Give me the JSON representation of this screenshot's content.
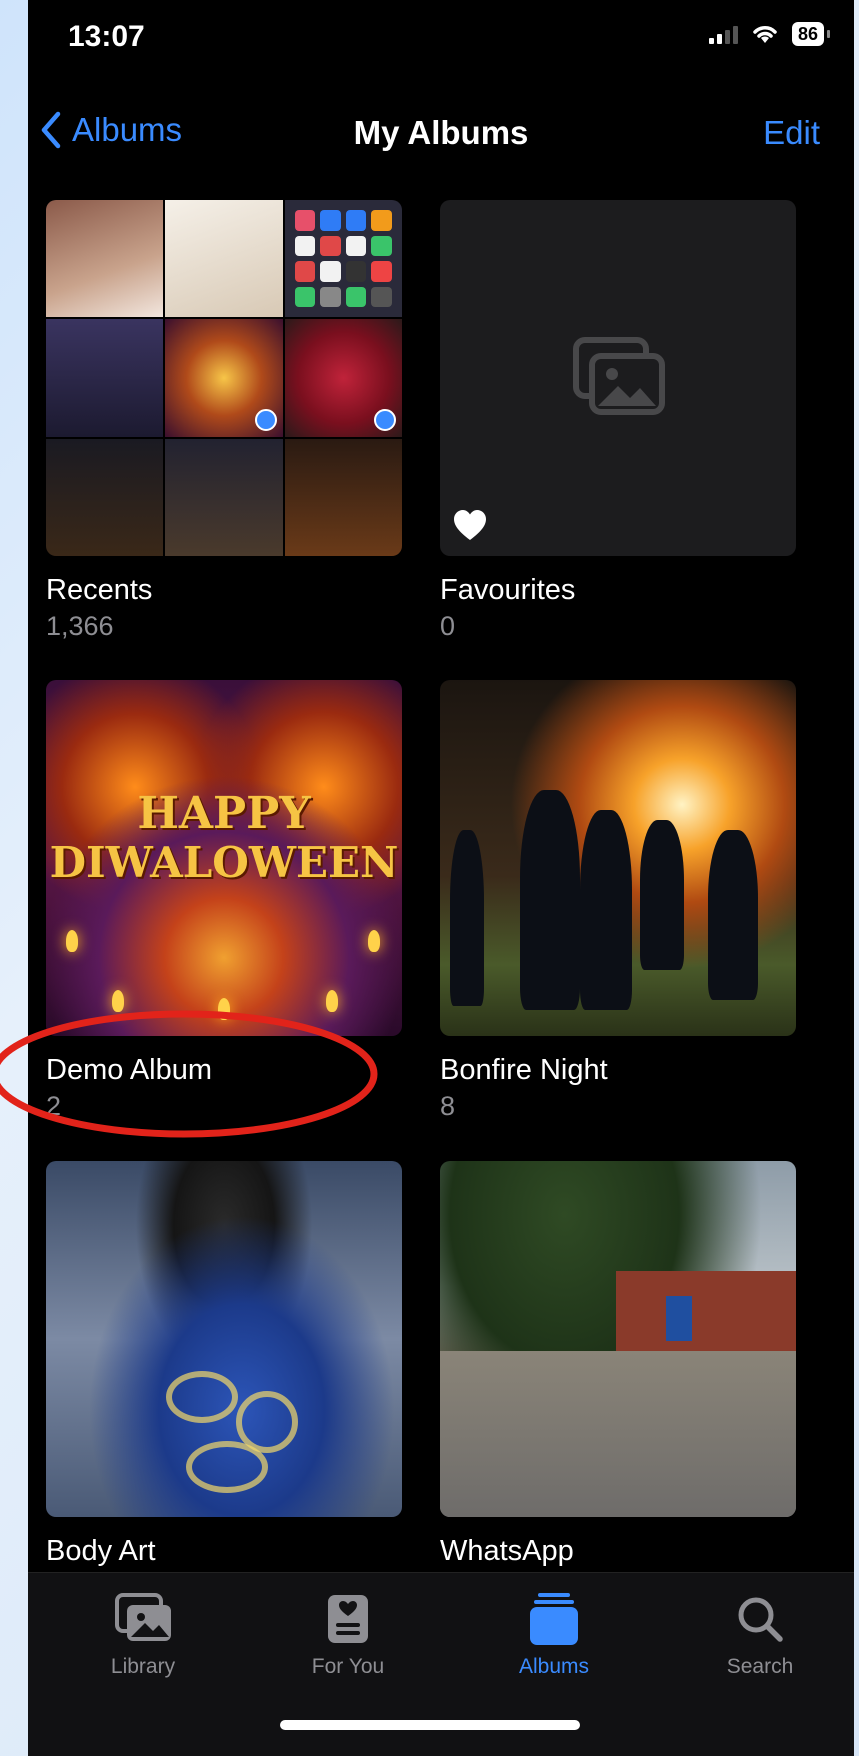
{
  "status_bar": {
    "time": "13:07",
    "battery": "86"
  },
  "nav": {
    "back_label": "Albums",
    "title": "My Albums",
    "edit_label": "Edit"
  },
  "albums": [
    {
      "title": "Recents",
      "count": "1,366"
    },
    {
      "title": "Favourites",
      "count": "0"
    },
    {
      "title": "Demo Album",
      "count": "2",
      "artwork_text": [
        "HAPPY",
        "DIWALOWEEN"
      ]
    },
    {
      "title": "Bonfire Night",
      "count": "8"
    },
    {
      "title": "Body Art"
    },
    {
      "title": "WhatsApp"
    }
  ],
  "tabs": [
    {
      "label": "Library",
      "icon": "library-icon"
    },
    {
      "label": "For You",
      "icon": "for-you-icon"
    },
    {
      "label": "Albums",
      "icon": "albums-icon",
      "active": true
    },
    {
      "label": "Search",
      "icon": "search-icon"
    }
  ],
  "colors": {
    "accent": "#3a8bff",
    "annotation": "#e2231a",
    "background": "#000000",
    "secondary_text": "#8e8e93"
  }
}
